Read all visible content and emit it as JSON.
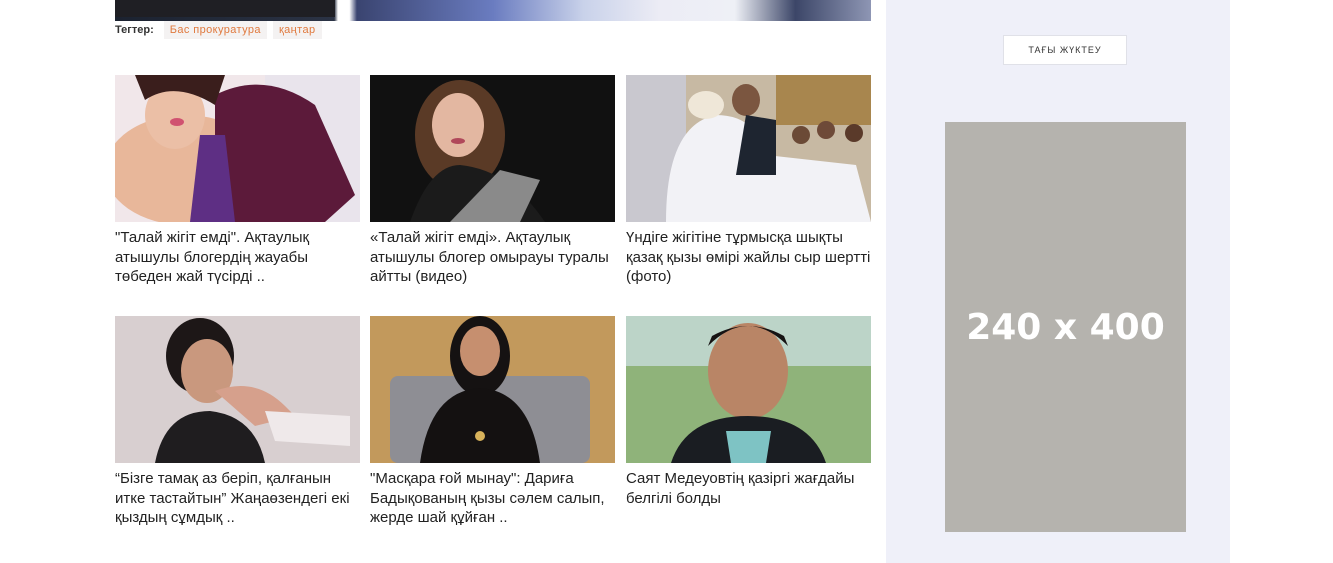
{
  "tags": {
    "label": "Тегтер:",
    "items": [
      "Бас прокуратура",
      "қаңтар"
    ]
  },
  "articles": [
    {
      "title": "\"Талай жігіт емді\". Ақтаулық атышулы блогердің жауабы төбеден жай түсірді ..",
      "image": "woman-purple-top-photo"
    },
    {
      "title": "«Талай жігіт емді». Ақтаулық атышулы блогер омырауы туралы айтты (видео)",
      "image": "woman-dark-studio-photo"
    },
    {
      "title": "Үндіге жігітіне тұрмысқа шықты қазақ қызы өмірі жайлы сыр шертті (фото)",
      "image": "wedding-couple-photo"
    },
    {
      "title": "“Бізге тамақ аз беріп, қалғанын итке тастайтын” Жаңаөзендегі екі қыздың сұмдық ..",
      "image": "crying-girl-photo"
    },
    {
      "title": "\"Масқара ғой мынау\": Дариға Бадықованың қызы сәлем салып, жерде шай құйған ..",
      "image": "woman-sofa-photo"
    },
    {
      "title": "Саят Медеуовтің қазіргі жағдайы белгілі болды",
      "image": "man-outdoor-photo"
    }
  ],
  "sidebar": {
    "load_more_label": "ТАҒЫ ЖҮКТЕУ",
    "ad_label": "240 x 400"
  },
  "colors": {
    "tag_text": "#e07a3f",
    "sidebar_bg": "#eff0f9",
    "ad_bg": "#b5b3ae"
  }
}
